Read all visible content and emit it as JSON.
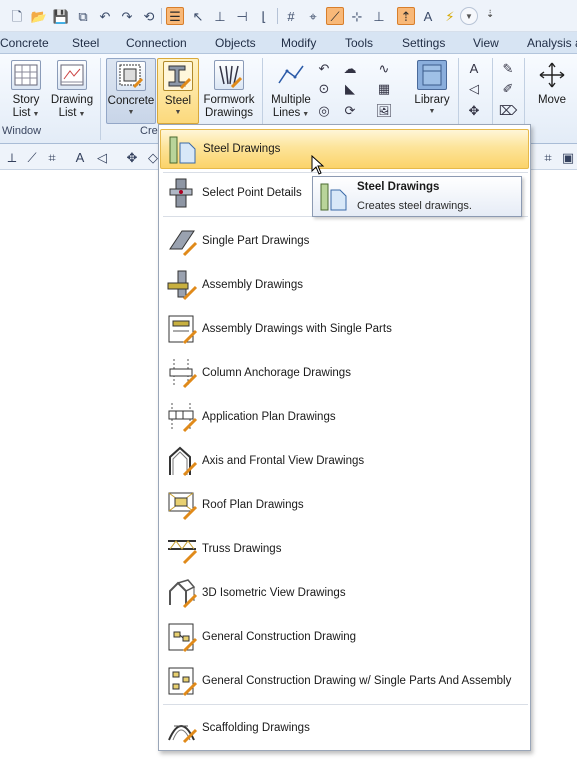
{
  "quick_access": {
    "icons": [
      "new-file-icon",
      "open-folder-icon",
      "save-icon",
      "save-all-icon",
      "undo-icon",
      "redo-icon",
      "refresh-icon",
      "layers-icon",
      "select-icon",
      "column-icon",
      "dimension-icon",
      "beam-icon",
      "grid-icon",
      "snap-icon",
      "line-snap-icon",
      "ortho-icon",
      "highlight-icon",
      "text-style-icon",
      "lightning-icon"
    ],
    "more_glyph": "⇣"
  },
  "tabs": [
    "Concrete",
    "Steel",
    "Connection",
    "Objects",
    "Modify",
    "Tools",
    "Settings",
    "View",
    "Analysis a"
  ],
  "ribbon": {
    "window_group": {
      "label": "Window",
      "buttons": [
        {
          "line1": "Story",
          "line2": "List"
        },
        {
          "line1": "Drawing",
          "line2": "List"
        }
      ]
    },
    "create_group": {
      "label": "Cre",
      "buttons": [
        {
          "line1": "Concrete",
          "line2": ""
        },
        {
          "line1": "Steel",
          "line2": ""
        },
        {
          "line1": "Formwork",
          "line2": "Drawings"
        }
      ]
    },
    "draw_group": {
      "multiple_lines": {
        "line1": "Multiple",
        "line2": "Lines"
      },
      "library": {
        "line1": "Library",
        "line2": ""
      }
    },
    "move": {
      "label": "Move"
    }
  },
  "menu": {
    "items": [
      {
        "id": "steel-drawings",
        "label": "Steel Drawings",
        "highlighted": true
      },
      {
        "id": "select-point-details",
        "label": "Select Point Details"
      },
      {
        "id": "single-part-drawings",
        "label": "Single Part Drawings"
      },
      {
        "id": "assembly-drawings",
        "label": "Assembly Drawings"
      },
      {
        "id": "assembly-drawings-single-parts",
        "label": "Assembly Drawings with Single Parts"
      },
      {
        "id": "column-anchorage-drawings",
        "label": "Column Anchorage Drawings"
      },
      {
        "id": "application-plan-drawings",
        "label": "Application Plan Drawings"
      },
      {
        "id": "axis-frontal-view-drawings",
        "label": "Axis and Frontal View Drawings"
      },
      {
        "id": "roof-plan-drawings",
        "label": "Roof Plan Drawings"
      },
      {
        "id": "truss-drawings",
        "label": "Truss Drawings"
      },
      {
        "id": "3d-isometric-view-drawings",
        "label": "3D Isometric View Drawings"
      },
      {
        "id": "general-construction-drawing",
        "label": "General Construction Drawing"
      },
      {
        "id": "general-construction-drawing-single-parts-assembly",
        "label": "General Construction Drawing w/ Single Parts And Assembly"
      },
      {
        "id": "scaffolding-drawings",
        "label": "Scaffolding Drawings"
      }
    ]
  },
  "tooltip": {
    "title": "Steel Drawings",
    "description": "Creates steel drawings."
  },
  "colors": {
    "highlight": "#fbd36a",
    "ribbon_bg": "#e3ecf7",
    "tab_bg": "#d7e4f3"
  }
}
